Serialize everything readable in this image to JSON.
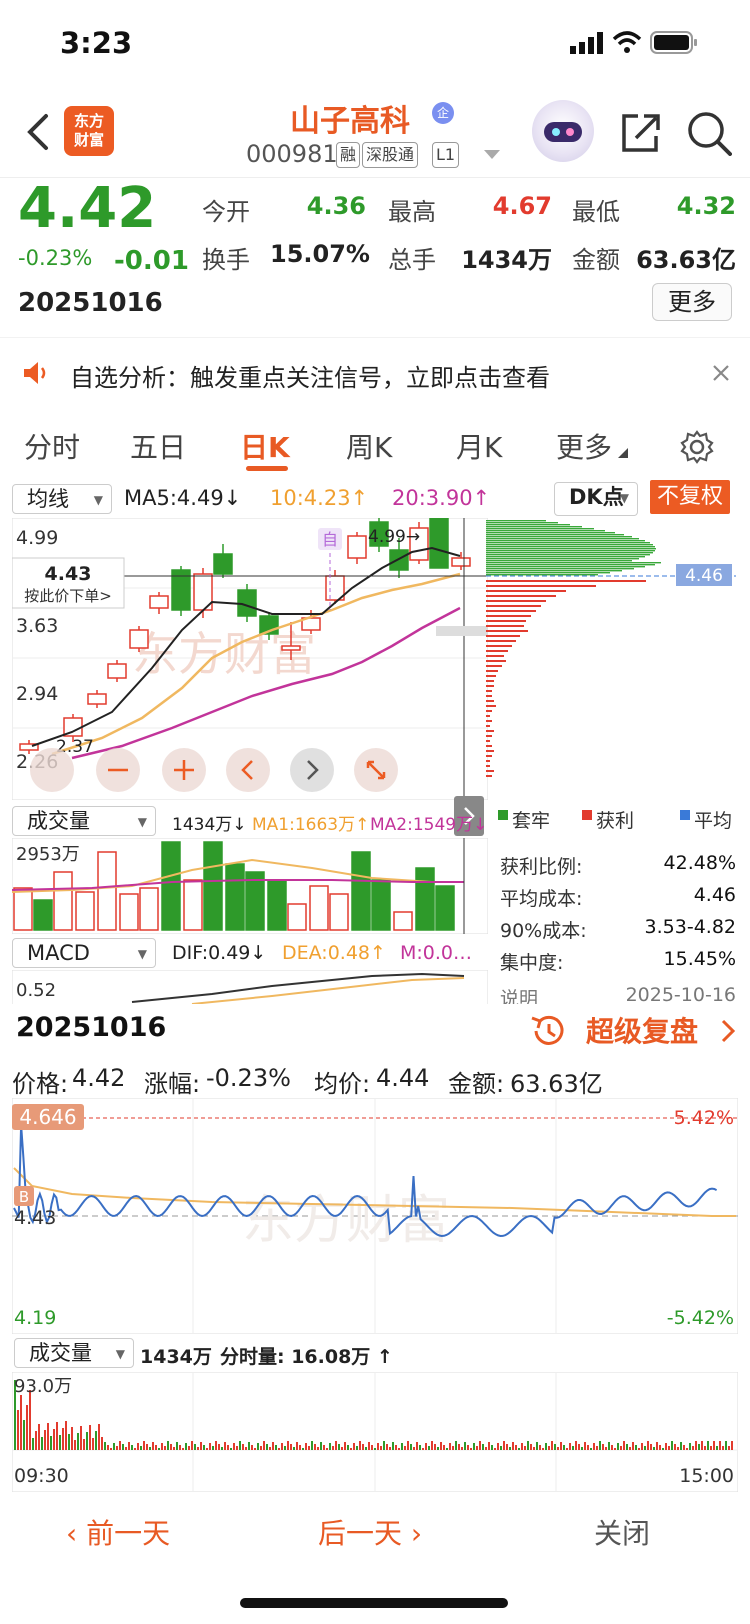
{
  "status": {
    "time": "3:23"
  },
  "header": {
    "logo": "东方\n财富",
    "stock_name": "山子高科",
    "enterprise_badge": "企",
    "code": "000981",
    "tags": [
      "融",
      "深股通",
      "L1"
    ]
  },
  "quote": {
    "price": "4.42",
    "change_pct": "-0.23%",
    "change": "-0.01",
    "date": "20251016",
    "open_label": "今开",
    "open": "4.36",
    "high_label": "最高",
    "high": "4.67",
    "low_label": "最低",
    "low": "4.32",
    "turnover_label": "换手",
    "turnover": "15.07%",
    "volume_label": "总手",
    "volume": "1434万",
    "amount_label": "金额",
    "amount": "63.63亿",
    "more": "更多"
  },
  "notice": {
    "text": "自选分析：触发重点关注信号，立即点击查看"
  },
  "tabs": [
    {
      "label": "分时"
    },
    {
      "label": "五日"
    },
    {
      "label": "日K"
    },
    {
      "label": "周K"
    },
    {
      "label": "月K"
    },
    {
      "label": "更多"
    }
  ],
  "kline": {
    "indicator": "均线",
    "ma5": "MA5:4.49↓",
    "ma10": "10:4.23↑",
    "ma20": "20:3.90↑",
    "dk": "DK点",
    "adjust": "不复权",
    "y_ticks": [
      "4.99",
      "3.63",
      "2.94",
      "2.26"
    ],
    "crosshair_price": "4.43",
    "order_hint": "按此价下单>",
    "high_mark": "4.99→",
    "low_mark": "2.37",
    "chip_price": "4.46",
    "self_mark": "自",
    "colors": {
      "up": "#e23b2e",
      "down": "#2e9a2a",
      "ma5": "#222222",
      "ma10": "#f0a030",
      "ma20": "#c2349a"
    }
  },
  "volume": {
    "indicator": "成交量",
    "value": "1434万↓",
    "ma1": "MA1:1663万↑",
    "ma2": "MA2:1549万↓",
    "max": "2953万"
  },
  "macd": {
    "indicator": "MACD",
    "dif": "DIF:0.49↓",
    "dea": "DEA:0.48↑",
    "m": "M:0.0…",
    "top": "0.52"
  },
  "chip": {
    "legend": [
      "套牢",
      "获利",
      "平均"
    ],
    "rows": [
      {
        "label": "获利比例:",
        "value": "42.48%"
      },
      {
        "label": "平均成本:",
        "value": "4.46"
      },
      {
        "label": "90%成本:",
        "value": "3.53-4.82"
      },
      {
        "label": "集中度:",
        "value": "15.45%"
      }
    ],
    "note_label": "说明",
    "note_date": "2025-10-16"
  },
  "replay": {
    "date": "20251016",
    "title": "超级复盘",
    "price_label": "价格:",
    "price": "4.42",
    "pct_label": "涨幅:",
    "pct": "-0.23%",
    "avg_label": "均价:",
    "avg": "4.44",
    "amount_label": "金额:",
    "amount": "63.63亿",
    "max_price": "4.646",
    "ref_price": "4.43",
    "min_price": "4.19",
    "max_pct": "5.42%",
    "min_pct": "-5.42%",
    "b_mark": "B",
    "vol_indicator": "成交量",
    "vol_text": "1434万",
    "tick_text": "分时量: 16.08万 ↑",
    "vol_max": "93.0万",
    "t_start": "09:30",
    "t_end": "15:00"
  },
  "bottom_nav": {
    "prev": "前一天",
    "next": "后一天",
    "close": "关闭"
  }
}
